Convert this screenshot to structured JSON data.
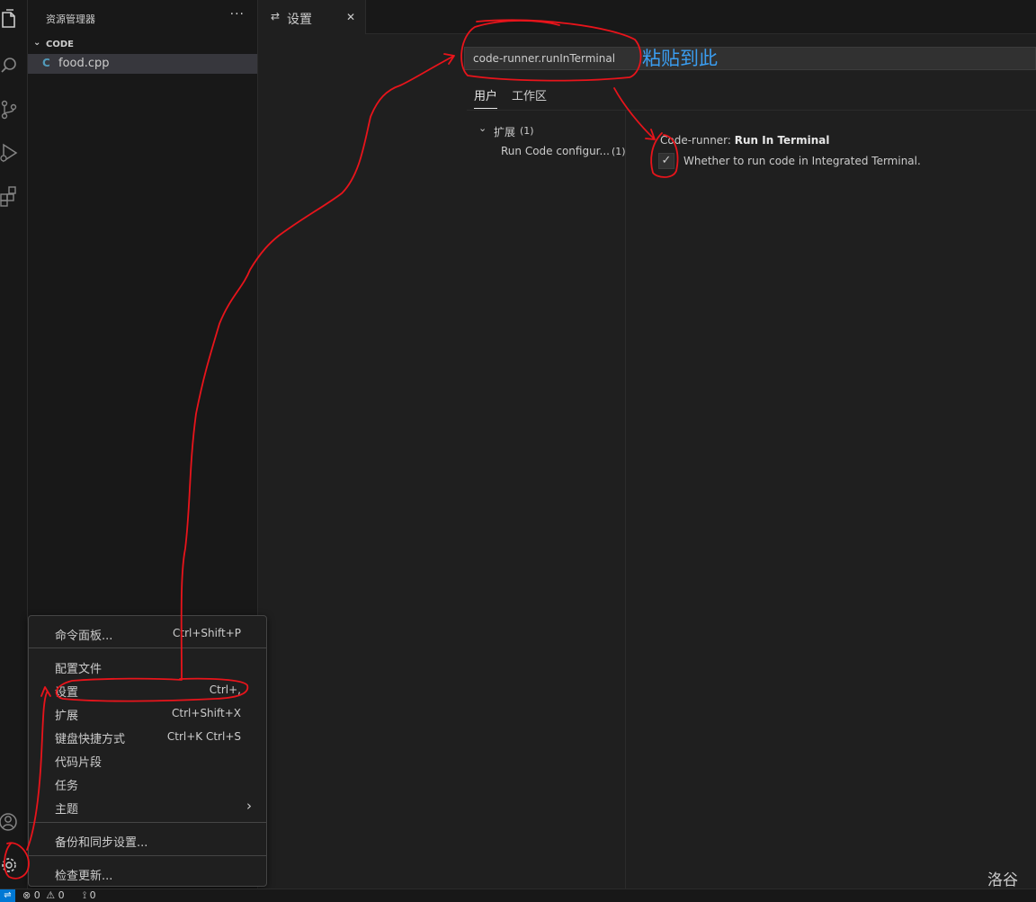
{
  "explorer": {
    "title": "资源管理器",
    "more": "···",
    "section": "CODE",
    "file": "food.cpp"
  },
  "editor": {
    "tab_label": "设置",
    "tab_close": "✕"
  },
  "settings": {
    "search_value": "code-runner.runInTerminal",
    "tabs": [
      "用户",
      "工作区"
    ],
    "toc_group": "扩展",
    "toc_group_count": "(1)",
    "toc_item": "Run Code configur...",
    "toc_item_count": "(1)",
    "setting_prefix": "Code-runner: ",
    "setting_name": "Run In Terminal",
    "setting_checked": true,
    "checkbox_glyph": "✓",
    "setting_description": "Whether to run code in Integrated Terminal."
  },
  "menu": {
    "items": [
      {
        "label": "命令面板...",
        "shortcut": "Ctrl+Shift+P"
      },
      {
        "label": "配置文件",
        "shortcut": ""
      },
      {
        "label": "设置",
        "shortcut": "Ctrl+,"
      },
      {
        "label": "扩展",
        "shortcut": "Ctrl+Shift+X"
      },
      {
        "label": "键盘快捷方式",
        "shortcut": "Ctrl+K Ctrl+S"
      },
      {
        "label": "代码片段",
        "shortcut": ""
      },
      {
        "label": "任务",
        "shortcut": ""
      },
      {
        "label": "主题",
        "shortcut": "›"
      },
      {
        "label": "备份和同步设置...",
        "shortcut": ""
      },
      {
        "label": "检查更新...",
        "shortcut": ""
      }
    ]
  },
  "status": {
    "errors": "0",
    "warnings": "0",
    "ports": "0"
  },
  "annotations": {
    "paste_note": "粘贴到此",
    "watermark": "洛谷",
    "color": "#e8141b"
  },
  "colors": {
    "accent": "#0078d4",
    "annotation_text": "#3a9df0"
  }
}
